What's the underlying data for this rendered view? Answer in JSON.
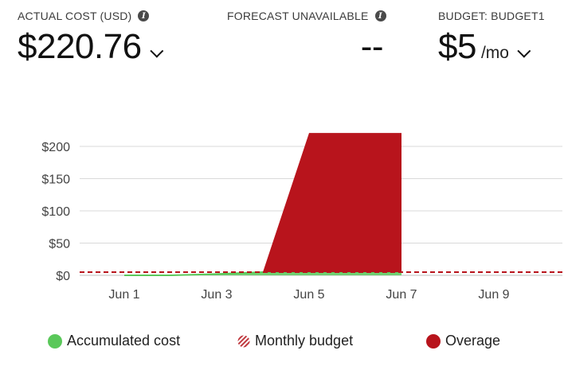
{
  "kpis": {
    "actual": {
      "label": "ACTUAL COST (USD)",
      "value": "$220.76"
    },
    "forecast": {
      "label": "FORECAST UNAVAILABLE",
      "value": "--"
    },
    "budget": {
      "label": "BUDGET: BUDGET1",
      "value": "$5",
      "suffix": "/mo"
    }
  },
  "legend": {
    "accumulated": "Accumulated cost",
    "budget": "Monthly budget",
    "overage": "Overage"
  },
  "colors": {
    "accumulated": "#5ac85a",
    "overage": "#b8141c",
    "budget_line": "#b8141c",
    "grid": "#d9d9d9"
  },
  "chart_data": {
    "type": "area",
    "y_ticks": [
      "$200",
      "$150",
      "$100",
      "$50",
      "$0"
    ],
    "x_ticks": [
      "Jun 1",
      "Jun 3",
      "Jun 5",
      "Jun 7",
      "Jun 9"
    ],
    "ylim": [
      0,
      220
    ],
    "budget": 5,
    "series": [
      {
        "name": "Accumulated cost",
        "x": [
          0,
          1,
          2,
          3,
          4,
          5,
          6
        ],
        "values": [
          0,
          0,
          2,
          5,
          5,
          5,
          5
        ]
      },
      {
        "name": "Overage",
        "x": [
          2,
          3,
          4,
          6
        ],
        "values": [
          0,
          0,
          215.76,
          215.76
        ]
      }
    ]
  }
}
